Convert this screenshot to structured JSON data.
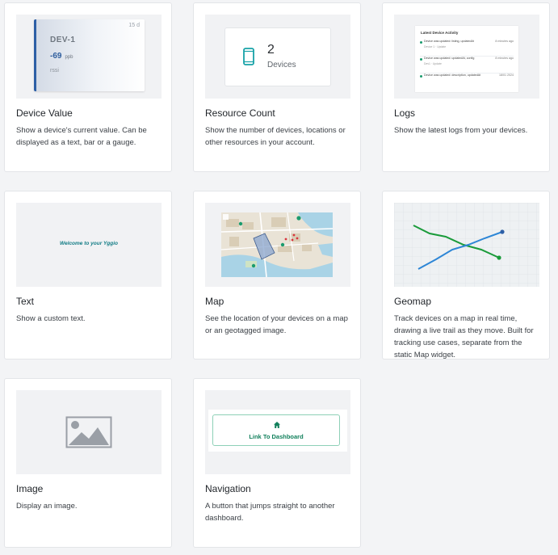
{
  "widgets": [
    {
      "title": "Device Value",
      "description": "Show a device's current value. Can be displayed as a text, bar or a gauge.",
      "preview": {
        "time": "15 d",
        "device": "DEV-1",
        "value": "-69",
        "unit": "ppb",
        "field": "rssi",
        "accent": "#2d5fa6"
      }
    },
    {
      "title": "Resource Count",
      "description": "Show the number of devices, locations or other resources in your account.",
      "preview": {
        "count": "2",
        "label": "Devices",
        "icon": "mobile-device-icon",
        "accent": "#17a2a8"
      }
    },
    {
      "title": "Logs",
      "description": "Show the latest logs from your devices.",
      "preview": {
        "heading": "Latest Device Activity",
        "rows": [
          {
            "message": "Device was updated: listing, updatedAt",
            "time": "8 minutes ago",
            "sub": "Device 1 · Update"
          },
          {
            "message": "Device was updated: updatedAt, config",
            "time": "8 minutes ago",
            "sub": "Dev1 · Update"
          },
          {
            "message": "Device was updated: description, updatedAt",
            "time": "18/01 2024",
            "sub": ""
          }
        ]
      }
    },
    {
      "title": "Text",
      "description": "Show a custom text.",
      "preview": {
        "text": "Welcome to your Yggio"
      }
    },
    {
      "title": "Map",
      "description": "See the location of your devices on a map or an geotagged image.",
      "preview": {
        "marker_color": "#1a9b6d",
        "alert_color": "#d9363e"
      }
    },
    {
      "title": "Geomap",
      "description": "Track devices on a map in real time, drawing a live trail as they move. Built for tracking use cases, separate from the static Map widget.",
      "preview": {
        "trail_a_color": "#2d86d6",
        "trail_b_color": "#1a9b3a"
      }
    },
    {
      "title": "Image",
      "description": "Display an image.",
      "preview": {
        "icon": "image-placeholder-icon"
      }
    },
    {
      "title": "Navigation",
      "description": "A button that jumps straight to another dashboard.",
      "preview": {
        "button_label": "Link To Dashboard",
        "icon": "home-icon",
        "accent": "#12805c"
      }
    }
  ]
}
